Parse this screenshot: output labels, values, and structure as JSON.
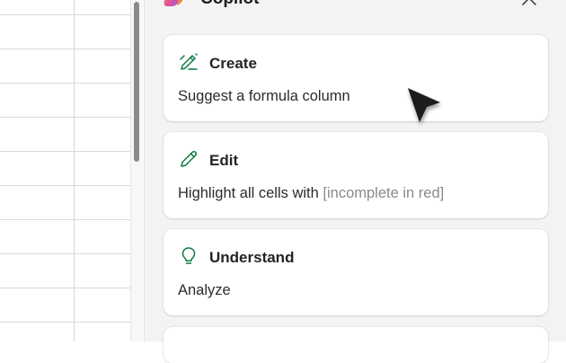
{
  "pane": {
    "title": "Copilot",
    "close_icon": "close-icon",
    "logo_icon": "copilot-logo-icon"
  },
  "cards": [
    {
      "icon": "pen-sparkle-icon",
      "title": "Create",
      "desc_text": "Suggest a formula column",
      "desc_placeholder": ""
    },
    {
      "icon": "pencil-icon",
      "title": "Edit",
      "desc_text": "Highlight all cells with ",
      "desc_placeholder": "[incomplete in red]"
    },
    {
      "icon": "lightbulb-icon",
      "title": "Understand",
      "desc_text": "Analyze",
      "desc_placeholder": ""
    }
  ],
  "colors": {
    "accent_icon": "#0e7a43",
    "pane_bg": "#f3f3f3",
    "card_bg": "#ffffff",
    "placeholder_text": "#8a8a8a"
  }
}
